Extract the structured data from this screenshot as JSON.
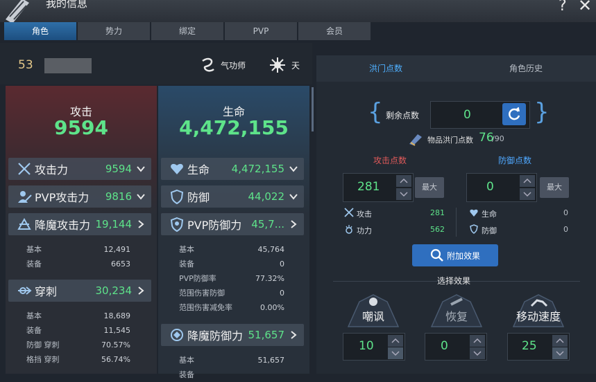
{
  "window": {
    "title": "我的信息",
    "help": "?",
    "close": "✕"
  },
  "tabs": [
    "角色",
    "势力",
    "绑定",
    "PVP",
    "会员"
  ],
  "header": {
    "level": "53",
    "class_name": "气功师",
    "element": "天"
  },
  "attack": {
    "title": "攻击",
    "total": "9594",
    "rows": [
      {
        "label": "攻击力",
        "value": "9594",
        "icon": "swords-icon",
        "chevron": "down"
      },
      {
        "label": "PVP攻击力",
        "value": "9816",
        "icon": "pvp-attack-icon",
        "chevron": "down"
      },
      {
        "label": "降魔攻击力",
        "value": "19,144",
        "icon": "demon-attack-icon",
        "chevron": "right"
      }
    ],
    "demon_sub": [
      {
        "k": "基本",
        "v": "12,491"
      },
      {
        "k": "装备",
        "v": "6653"
      }
    ],
    "pierce": {
      "label": "穿刺",
      "value": "30,234",
      "icon": "pierce-icon"
    },
    "pierce_sub": [
      {
        "k": "基本",
        "v": "18,689"
      },
      {
        "k": "装备",
        "v": "11,545"
      },
      {
        "k": "防御 穿刺",
        "v": "70.57%"
      },
      {
        "k": "格挡 穿刺",
        "v": "56.74%"
      }
    ]
  },
  "health": {
    "title": "生命",
    "total": "4,472,155",
    "rows": [
      {
        "label": "生命",
        "value": "4,472,155",
        "icon": "heart-icon",
        "chevron": "down"
      },
      {
        "label": "防御",
        "value": "44,022",
        "icon": "shield-icon",
        "chevron": "down"
      },
      {
        "label": "PVP防御力",
        "value": "45,7...",
        "icon": "pvp-defense-icon",
        "chevron": "right"
      }
    ],
    "pvp_sub": [
      {
        "k": "基本",
        "v": "45,764"
      },
      {
        "k": "装备",
        "v": "0"
      },
      {
        "k": "PVP防御率",
        "v": "77.32%"
      },
      {
        "k": "范围伤害防御",
        "v": "0"
      },
      {
        "k": "范围伤害减免率",
        "v": "0.00%"
      }
    ],
    "demon_def": {
      "label": "降魔防御力",
      "value": "51,657",
      "icon": "demon-defense-icon"
    },
    "demon_def_sub": [
      {
        "k": "基本",
        "v": "51,657"
      },
      {
        "k": "装备",
        "v": ""
      }
    ]
  },
  "right": {
    "tabs": [
      "洪门点数",
      "角色历史"
    ],
    "remaining_label": "剩余点数",
    "remaining": "0",
    "item_points_label": "物品洪门点数",
    "item_points": "76",
    "item_points_max": "/90",
    "attack_points": {
      "title": "攻击点数",
      "value": "281",
      "max_label": "最大",
      "items": [
        {
          "k": "攻击",
          "v": "281"
        },
        {
          "k": "功力",
          "v": "562"
        }
      ]
    },
    "defense_points": {
      "title": "防御点数",
      "value": "0",
      "max_label": "最大",
      "items": [
        {
          "k": "生命",
          "v": "0"
        },
        {
          "k": "防御",
          "v": "0"
        }
      ]
    },
    "effect_button": "附加效果",
    "choose_effect": "选择效果",
    "effects": [
      {
        "title": "嘲讽",
        "value": "10"
      },
      {
        "title": "恢复",
        "value": "0"
      },
      {
        "title": "移动速度",
        "value": "25"
      }
    ]
  },
  "colors": {
    "green": "#5ee38a",
    "blue_accent": "#2f6fbf",
    "attack_red": "#e05a5a",
    "defense_blue": "#4fa8ff"
  }
}
